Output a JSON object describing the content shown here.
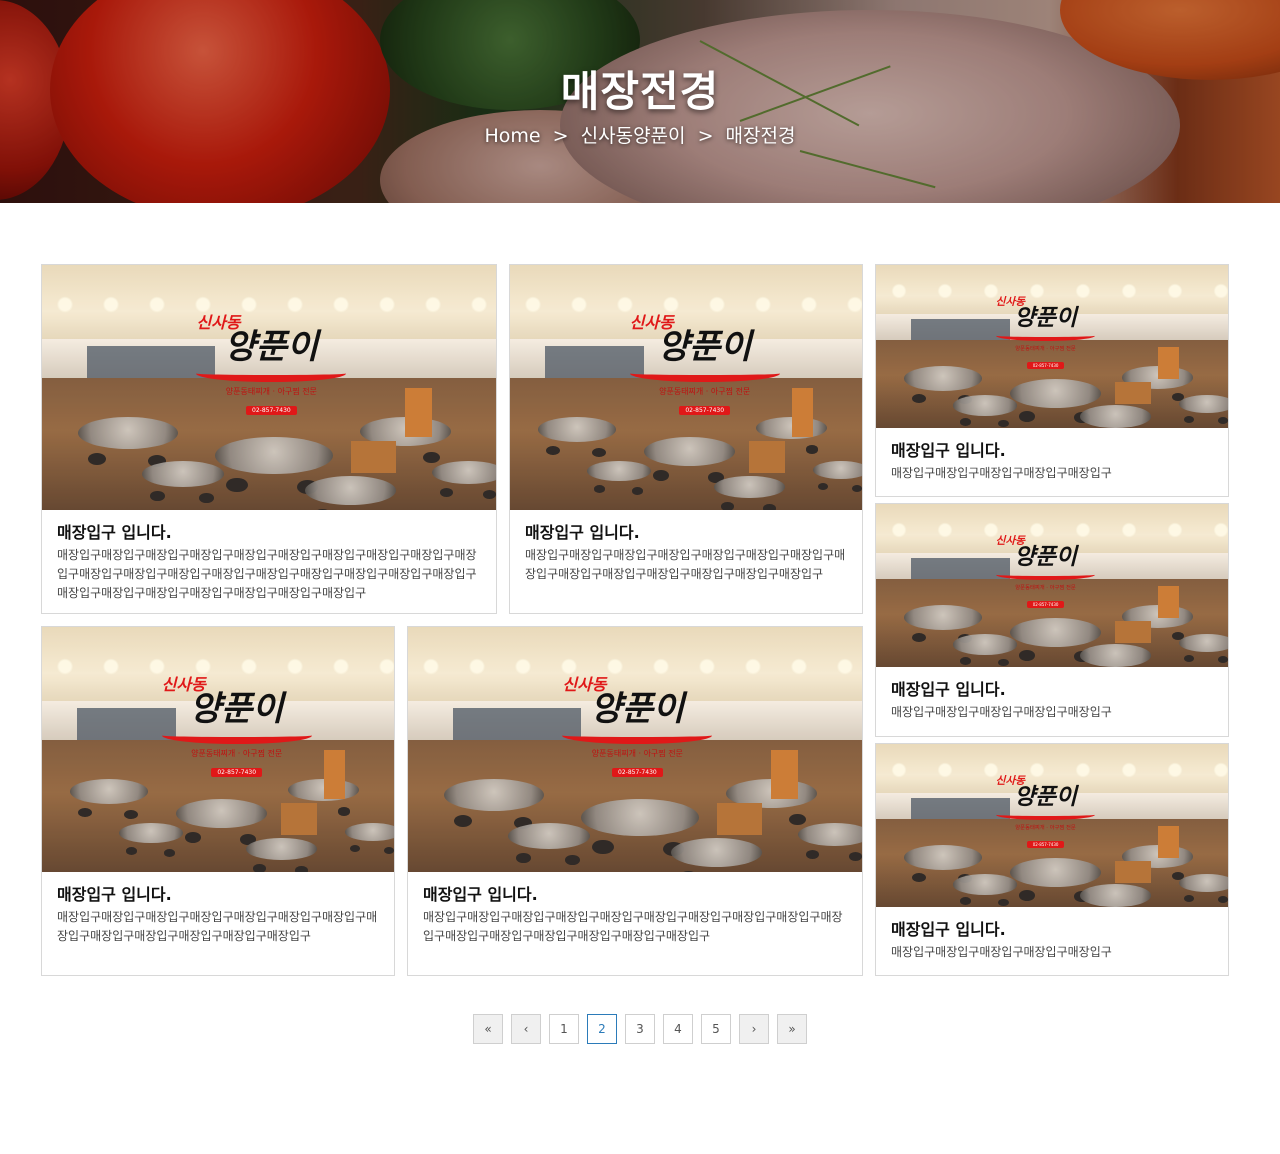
{
  "hero": {
    "title": "매장전경",
    "breadcrumb": [
      {
        "label": "Home"
      },
      {
        "label": "신사동양푼이"
      },
      {
        "label": "매장전경"
      }
    ],
    "separator": ">"
  },
  "logo": {
    "small_text": "신사동",
    "big_text": "양푼이",
    "sub_text": "양푼동태찌개 · 아구찜 전문",
    "phone": "02-857-7430"
  },
  "cards": [
    {
      "title": "매장입구 입니다.",
      "desc": "매장입구매장입구매장입구매장입구매장입구매장입구매장입구매장입구매장입구매장입구매장입구매장입구매장입구매장입구매장입구매장입구매장입구매장입구매장입구매장입구매장입구매장입구매장입구매장입구매장입구매장입구"
    },
    {
      "title": "매장입구 입니다.",
      "desc": "매장입구매장입구매장입구매장입구매장입구매장입구매장입구매장입구매장입구매장입구매장입구매장입구매장입구매장입구"
    },
    {
      "title": "매장입구 입니다.",
      "desc": "매장입구매장입구매장입구매장입구매장입구"
    },
    {
      "title": "매장입구 입니다.",
      "desc": "매장입구매장입구매장입구매장입구매장입구"
    },
    {
      "title": "매장입구 입니다.",
      "desc": "매장입구매장입구매장입구매장입구매장입구매장입구매장입구매장입구매장입구매장입구매장입구매장입구매장입구"
    },
    {
      "title": "매장입구 입니다.",
      "desc": "매장입구매장입구매장입구매장입구매장입구매장입구매장입구매장입구매장입구매장입구매장입구매장입구매장입구매장입구매장입구매장입구"
    },
    {
      "title": "매장입구 입니다.",
      "desc": "매장입구매장입구매장입구매장입구매장입구"
    }
  ],
  "pagination": {
    "first": "«",
    "prev": "‹",
    "pages": [
      "1",
      "2",
      "3",
      "4",
      "5"
    ],
    "current": 2,
    "next": "›",
    "last": "»"
  }
}
